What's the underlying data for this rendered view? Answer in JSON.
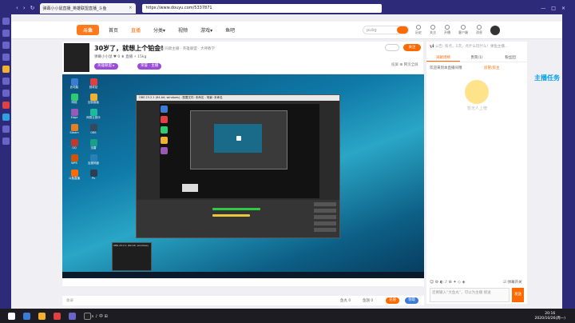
{
  "browser": {
    "tab_title": "弹幕小小鼠直播_英雄联盟直播_斗鱼",
    "url": "https://www.douyu.com/5337871",
    "window_controls": [
      "—",
      "□",
      "×"
    ]
  },
  "header": {
    "logo": "斗鱼",
    "nav": [
      "首页",
      "直播",
      "分类▾",
      "视频",
      "游戏▾",
      "鱼吧"
    ],
    "active_nav": "直播",
    "search_placeholder": "pubg",
    "icons": [
      "历史",
      "关注",
      "开播",
      "客户端",
      "消息"
    ]
  },
  "room": {
    "title": "30岁了，就想上个铂金!",
    "meta": "举报  同款主播 · 英雄联盟 · 大神教学",
    "subline": "弹幕小小鼠 ♥ 0  ♛ 直播  ⚡ 15kg",
    "badge1": "英雄联盟 ▸",
    "badge2": "荣誉 · 主播",
    "follow": "关注",
    "ctl_right": "投屏  ⊞ 网页全屏"
  },
  "obs": {
    "title": "OBS 23.2.1 (64-bit, windows) - 配置文件: 未命名 - 场景: 未命名",
    "popup_title": "OBS 23.2.1 (64-bit, windows)"
  },
  "desktop_labels": [
    "此电脑",
    "回收站",
    "网络",
    "控制面板",
    "Edge",
    "网易云音乐",
    "Steam",
    "OBS",
    "QQ",
    "迅雷",
    "WPS",
    "百度网盘",
    "斗鱼直播",
    "Ps"
  ],
  "chat": {
    "notice": "📢 公告: 有点，1次，点什么玩什么！弹鱼主播...",
    "tabs": [
      "贡献周榜",
      "贵宾(1)",
      "粉丝团"
    ],
    "active_tab": "贡献周榜",
    "tab_right": "房管/房主",
    "msg": "欢迎来到本直播间哦",
    "mascot_text": "暂无人上榜",
    "input_placeholder": "还剩输入“大鱼丸”，可以为主播 接送",
    "send": "发送",
    "toolbar": "☺ ⚙ ◐ ♪ ⊕ ✦ ◇ ◈",
    "danmu_toggle": "☑ 弹幕开关"
  },
  "promo": "主播任务",
  "bottom": {
    "left": "收录",
    "items": [
      "鱼丸 0",
      "鱼翅 0"
    ],
    "gift1": "充值",
    "gift2": "领取"
  },
  "taskbar": {
    "time": "20:16",
    "date": "2020/10/26(周一)",
    "tray": "∧ ♪ 中 ⊞"
  },
  "colors": {
    "accent": "#ff6a00",
    "browser": "#2e2a7a",
    "badge": "#9a4bd8"
  }
}
